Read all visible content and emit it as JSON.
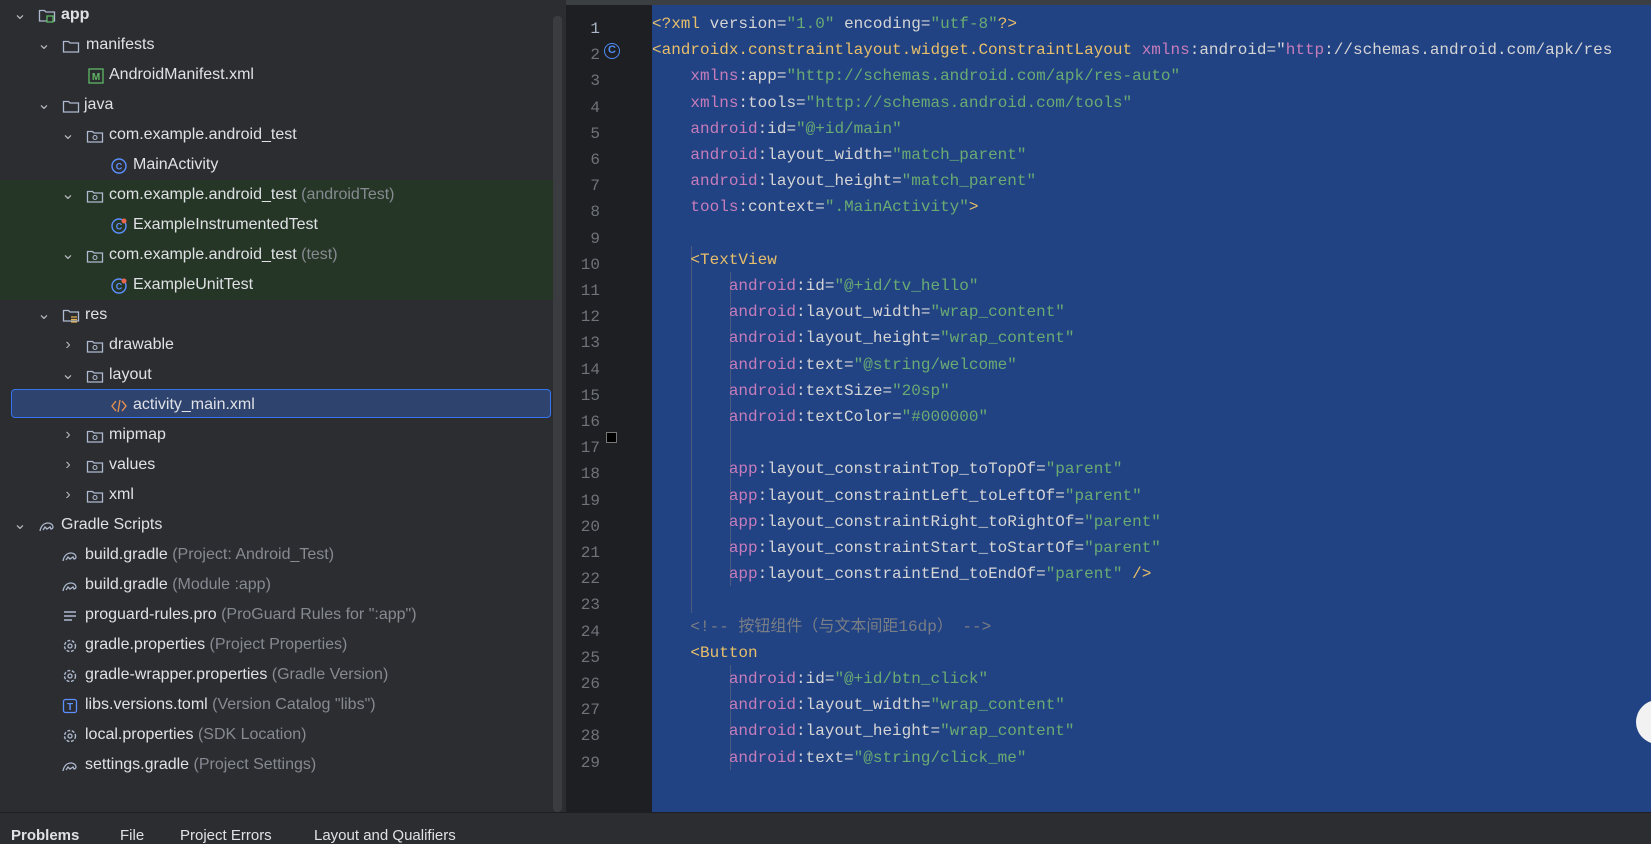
{
  "project_tree": {
    "rows": [
      {
        "label": "app",
        "hint": ""
      },
      {
        "label": "manifests",
        "hint": ""
      },
      {
        "label": "AndroidManifest.xml",
        "hint": ""
      },
      {
        "label": "java",
        "hint": ""
      },
      {
        "label": "com.example.android_test",
        "hint": ""
      },
      {
        "label": "MainActivity",
        "hint": ""
      },
      {
        "label": "com.example.android_test",
        "hint": "(androidTest)"
      },
      {
        "label": "ExampleInstrumentedTest",
        "hint": ""
      },
      {
        "label": "com.example.android_test",
        "hint": "(test)"
      },
      {
        "label": "ExampleUnitTest",
        "hint": ""
      },
      {
        "label": "res",
        "hint": ""
      },
      {
        "label": "drawable",
        "hint": ""
      },
      {
        "label": "layout",
        "hint": ""
      },
      {
        "label": "activity_main.xml",
        "hint": ""
      },
      {
        "label": "mipmap",
        "hint": ""
      },
      {
        "label": "values",
        "hint": ""
      },
      {
        "label": "xml",
        "hint": ""
      },
      {
        "label": "Gradle Scripts",
        "hint": ""
      },
      {
        "label": "build.gradle",
        "hint": "(Project: Android_Test)"
      },
      {
        "label": "build.gradle",
        "hint": "(Module :app)"
      },
      {
        "label": "proguard-rules.pro",
        "hint": "(ProGuard Rules for \":app\")"
      },
      {
        "label": "gradle.properties",
        "hint": "(Project Properties)"
      },
      {
        "label": "gradle-wrapper.properties",
        "hint": "(Gradle Version)"
      },
      {
        "label": "libs.versions.toml",
        "hint": "(Version Catalog \"libs\")"
      },
      {
        "label": "local.properties",
        "hint": "(SDK Location)"
      },
      {
        "label": "settings.gradle",
        "hint": "(Project Settings)"
      }
    ]
  },
  "editor": {
    "line_numbers": [
      "1",
      "2",
      "3",
      "4",
      "5",
      "6",
      "7",
      "8",
      "9",
      "10",
      "11",
      "12",
      "13",
      "14",
      "15",
      "16",
      "17",
      "18",
      "19",
      "20",
      "21",
      "22",
      "23",
      "24",
      "25",
      "26",
      "27",
      "28",
      "29"
    ],
    "lines": [
      "<?xml version=\"1.0\" encoding=\"utf-8\"?>",
      "<androidx.constraintlayout.widget.ConstraintLayout xmlns:android=\"http://schemas.android.com/apk/res",
      "    xmlns:app=\"http://schemas.android.com/apk/res-auto\"",
      "    xmlns:tools=\"http://schemas.android.com/tools\"",
      "    android:id=\"@+id/main\"",
      "    android:layout_width=\"match_parent\"",
      "    android:layout_height=\"match_parent\"",
      "    tools:context=\".MainActivity\">",
      "",
      "    <TextView",
      "        android:id=\"@+id/tv_hello\"",
      "        android:layout_width=\"wrap_content\"",
      "        android:layout_height=\"wrap_content\"",
      "        android:text=\"@string/welcome\"",
      "        android:textSize=\"20sp\"",
      "        android:textColor=\"#000000\"",
      "",
      "        app:layout_constraintTop_toTopOf=\"parent\"",
      "        app:layout_constraintLeft_toLeftOf=\"parent\"",
      "        app:layout_constraintRight_toRightOf=\"parent\"",
      "        app:layout_constraintStart_toStartOf=\"parent\"",
      "        app:layout_constraintEnd_toEndOf=\"parent\" />",
      "",
      "    <!-- 按钮组件（与文本间距16dp） -->",
      "    <Button",
      "        android:id=\"@+id/btn_click\"",
      "        android:layout_width=\"wrap_content\"",
      "        android:layout_height=\"wrap_content\"",
      "        android:text=\"@string/click_me\""
    ],
    "color_swatch": "#000000"
  },
  "bottom_tabs": [
    "Problems",
    "File",
    "Project Errors",
    "Layout and Qualifiers"
  ]
}
